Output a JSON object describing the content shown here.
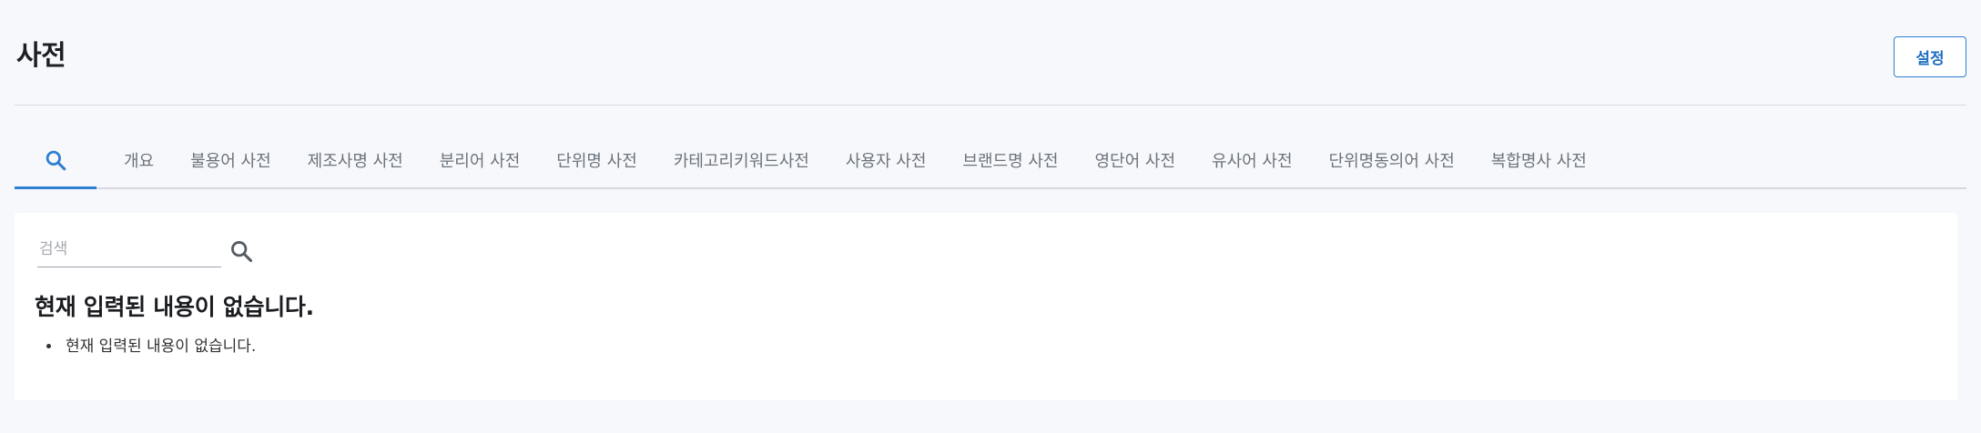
{
  "page": {
    "title": "사전",
    "settings_label": "설정"
  },
  "tabs": [
    {
      "icon": "search-icon",
      "label": "",
      "active": true
    },
    {
      "label": "개요"
    },
    {
      "label": "불용어 사전"
    },
    {
      "label": "제조사명 사전"
    },
    {
      "label": "분리어 사전"
    },
    {
      "label": "단위명 사전"
    },
    {
      "label": "카테고리키워드사전"
    },
    {
      "label": "사용자 사전"
    },
    {
      "label": "브랜드명 사전"
    },
    {
      "label": "영단어 사전"
    },
    {
      "label": "유사어 사전"
    },
    {
      "label": "단위명동의어 사전"
    },
    {
      "label": "복합명사 사전"
    }
  ],
  "search": {
    "placeholder": "검색",
    "value": "",
    "button_icon": "search-icon"
  },
  "result": {
    "title": "현재 입력된 내용이 없습니다.",
    "items": [
      "현재 입력된 내용이 없습니다."
    ]
  },
  "colors": {
    "accent": "#2f7fd1",
    "background": "#f7f8fb",
    "card": "#ffffff"
  }
}
